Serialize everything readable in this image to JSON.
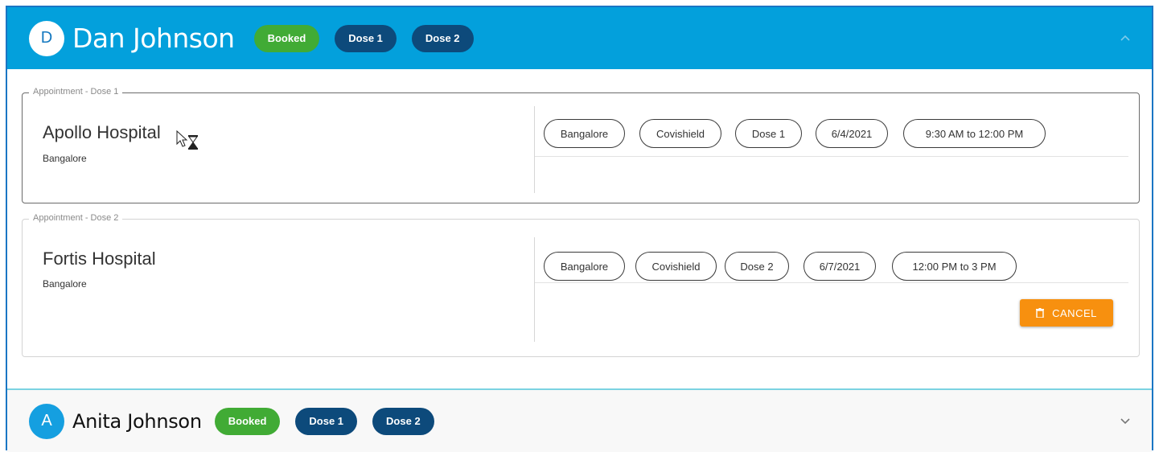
{
  "expanded_person": {
    "initial": "D",
    "name": "Dan Johnson",
    "status_badge": "Booked",
    "dose_badges": [
      "Dose 1",
      "Dose 2"
    ],
    "toggle_icon": "chevron-up-icon"
  },
  "appointments": [
    {
      "legend": "Appointment - Dose 1",
      "hospital": "Apollo Hospital",
      "city": "Bangalore",
      "chips": [
        "Bangalore",
        "Covishield",
        "Dose 1",
        "6/4/2021",
        "9:30 AM to 12:00 PM"
      ]
    },
    {
      "legend": "Appointment - Dose 2",
      "hospital": "Fortis Hospital",
      "city": "Bangalore",
      "chips": [
        "Bangalore",
        "Covishield",
        "Dose 2",
        "6/7/2021",
        "12:00 PM to 3 PM"
      ],
      "cancel_label": "CANCEL"
    }
  ],
  "collapsed_person": {
    "initial": "A",
    "name": "Anita Johnson",
    "status_badge": "Booked",
    "dose_badges": [
      "Dose 1",
      "Dose 2"
    ],
    "toggle_icon": "chevron-down-icon"
  },
  "colors": {
    "header_bg": "#03a0dc",
    "booked_green": "#41ab35",
    "dose_navy": "#0d4a7b",
    "cancel_orange": "#f7900f"
  }
}
